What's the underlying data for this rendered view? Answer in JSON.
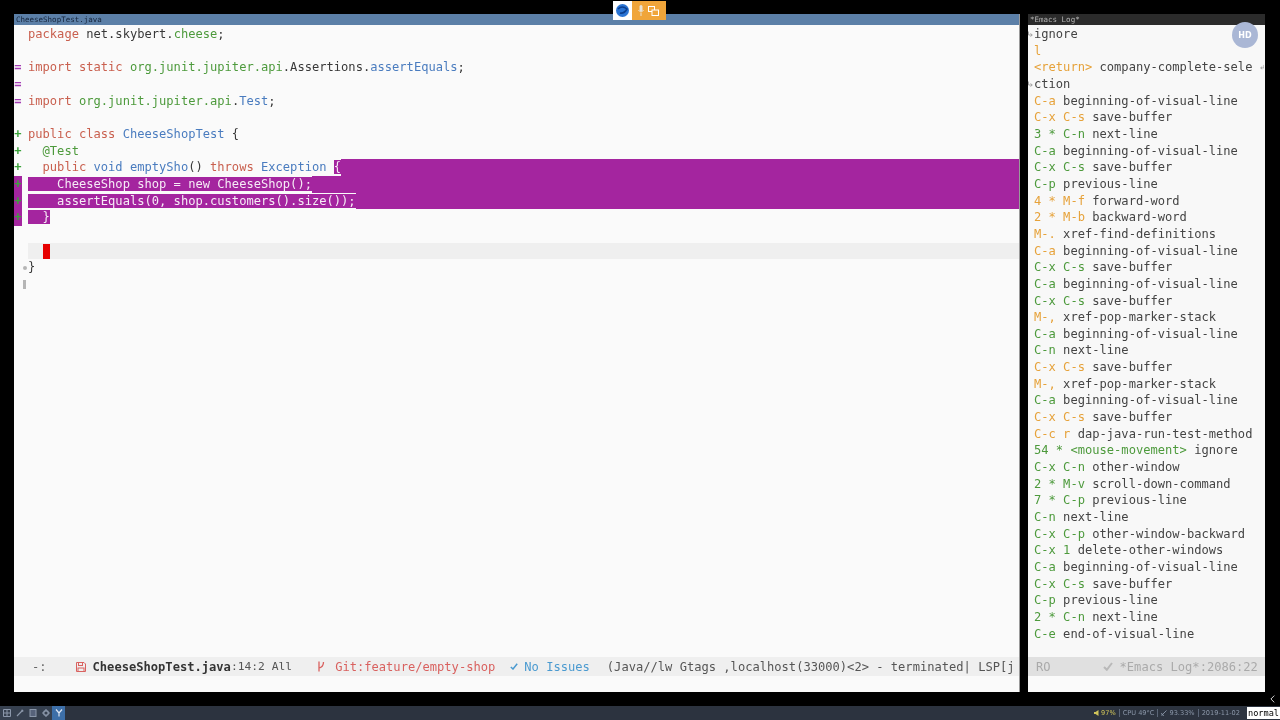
{
  "editor": {
    "title": "CheeseShopTest.java",
    "lines": [
      {
        "tokens": [
          {
            "text": "package",
            "kind": "keyword",
            "selected": false
          },
          {
            "text": " net.skybert.",
            "kind": "plain",
            "selected": false
          },
          {
            "text": "cheese",
            "kind": "namespace",
            "selected": false
          },
          {
            "text": ";",
            "kind": "plain",
            "selected": false
          }
        ],
        "current": false,
        "cursor": false,
        "selection_to_eol": false
      },
      {
        "current": false,
        "cursor": false,
        "selection_to_eol": false
      },
      {
        "marker": {
          "text": "=",
          "kind": "modified"
        },
        "tokens": [
          {
            "text": "import static ",
            "kind": "keyword",
            "selected": false
          },
          {
            "text": "org.junit.jupiter.api",
            "kind": "namespace",
            "selected": false
          },
          {
            "text": ".Assertions.",
            "kind": "plain",
            "selected": false
          },
          {
            "text": "assertEquals",
            "kind": "type",
            "selected": false
          },
          {
            "text": ";",
            "kind": "plain",
            "selected": false
          }
        ],
        "current": false,
        "cursor": false,
        "selection_to_eol": false
      },
      {
        "marker": {
          "text": "=",
          "kind": "modified"
        },
        "current": false,
        "cursor": false,
        "selection_to_eol": false
      },
      {
        "marker": {
          "text": "=",
          "kind": "modified"
        },
        "tokens": [
          {
            "text": "import ",
            "kind": "keyword",
            "selected": false
          },
          {
            "text": "org.junit.jupiter.api",
            "kind": "namespace",
            "selected": false
          },
          {
            "text": ".",
            "kind": "plain",
            "selected": false
          },
          {
            "text": "Test",
            "kind": "type",
            "selected": false
          },
          {
            "text": ";",
            "kind": "plain",
            "selected": false
          }
        ],
        "current": false,
        "cursor": false,
        "selection_to_eol": false
      },
      {
        "current": false,
        "cursor": false,
        "selection_to_eol": false
      },
      {
        "marker": {
          "text": "+",
          "kind": "added"
        },
        "tokens": [
          {
            "text": "public class ",
            "kind": "keyword",
            "selected": false
          },
          {
            "text": "CheeseShopTest",
            "kind": "type",
            "selected": false
          },
          {
            "text": " {",
            "kind": "plain",
            "selected": false
          }
        ],
        "current": false,
        "cursor": false,
        "selection_to_eol": false
      },
      {
        "marker": {
          "text": "+",
          "kind": "added"
        },
        "tokens": [
          {
            "text": "  @Test",
            "kind": "namespace",
            "selected": false
          }
        ],
        "current": false,
        "cursor": false,
        "selection_to_eol": false
      },
      {
        "marker": {
          "text": "+",
          "kind": "added"
        },
        "tokens": [
          {
            "text": "  public ",
            "kind": "keyword",
            "selected": false
          },
          {
            "text": "void emptySho",
            "kind": "type",
            "selected": false
          },
          {
            "text": "() ",
            "kind": "plain",
            "selected": false
          },
          {
            "text": "throws ",
            "kind": "keyword",
            "selected": false
          },
          {
            "text": "Exception ",
            "kind": "type",
            "selected": false
          },
          {
            "text": "{",
            "selected": true
          }
        ],
        "current": false,
        "cursor": false,
        "selection_to_eol": true
      },
      {
        "marker": {
          "text": "+",
          "kind": "added"
        },
        "tokens": [
          {
            "text": "    CheeseShop shop = new CheeseShop();",
            "selected": true
          }
        ],
        "current": false,
        "cursor": false,
        "selection_to_eol": true
      },
      {
        "marker": {
          "text": "+",
          "kind": "added"
        },
        "tokens": [
          {
            "text": "    assertEquals(0, shop.customers().size());",
            "selected": true
          }
        ],
        "current": false,
        "cursor": false,
        "selection_to_eol": true
      },
      {
        "marker": {
          "text": "+",
          "kind": "added"
        },
        "tokens": [
          {
            "text": "  }",
            "selected": true
          }
        ],
        "current": false,
        "cursor": false,
        "selection_to_eol": false
      },
      {
        "current": false,
        "cursor": false,
        "selection_to_eol": false
      },
      {
        "current": true,
        "cursor": true,
        "selection_to_eol": false
      },
      {
        "fringe": {
          "kind": "dot"
        },
        "tokens": [
          {
            "text": "}",
            "kind": "plain",
            "selected": false
          }
        ],
        "current": false,
        "cursor": false,
        "selection_to_eol": false
      },
      {
        "fringe": {
          "kind": "bar"
        },
        "current": false,
        "cursor": false,
        "selection_to_eol": false
      }
    ],
    "mode_line": {
      "state": "-:",
      "buffer": "CheeseShopTest.java",
      "position": ":14:2 All",
      "branch": "Git:feature/empty-shop",
      "checker": "No Issues",
      "modes": "(Java//lw Gtags ,localhost(33000)<2> - terminated| LSP[j"
    }
  },
  "log_window": {
    "title": "*Emacs Log*",
    "lines": [
      {
        "command": "ignore",
        "continued": true,
        "wraps": false
      },
      {
        "keys": "l",
        "highlighted": true,
        "continued": false,
        "wraps": false
      },
      {
        "keys": "<return>",
        "command": "company-complete-sele",
        "highlighted": true,
        "continued": false,
        "wraps": true
      },
      {
        "command": "ction",
        "continued": true,
        "wraps": false
      },
      {
        "keys": "C-a",
        "command": "beginning-of-visual-line",
        "highlighted": true,
        "continued": false,
        "wraps": false
      },
      {
        "keys": "C-x C-s",
        "command": "save-buffer",
        "highlighted": true,
        "continued": false,
        "wraps": false
      },
      {
        "keys": "3 * C-n",
        "command": "next-line",
        "highlighted": false,
        "continued": false,
        "wraps": false
      },
      {
        "keys": "C-a",
        "command": "beginning-of-visual-line",
        "highlighted": false,
        "continued": false,
        "wraps": false
      },
      {
        "keys": "C-x C-s",
        "command": "save-buffer",
        "highlighted": false,
        "continued": false,
        "wraps": false
      },
      {
        "keys": "C-p",
        "command": "previous-line",
        "highlighted": false,
        "continued": false,
        "wraps": false
      },
      {
        "keys": "4 * M-f",
        "command": "forward-word",
        "highlighted": true,
        "continued": false,
        "wraps": false
      },
      {
        "keys": "2 * M-b",
        "command": "backward-word",
        "highlighted": true,
        "continued": false,
        "wraps": false
      },
      {
        "keys": "M-.",
        "command": "xref-find-definitions",
        "highlighted": true,
        "continued": false,
        "wraps": false
      },
      {
        "keys": "C-a",
        "command": "beginning-of-visual-line",
        "highlighted": true,
        "continued": false,
        "wraps": false
      },
      {
        "keys": "C-x C-s",
        "command": "save-buffer",
        "highlighted": false,
        "continued": false,
        "wraps": false
      },
      {
        "keys": "C-a",
        "command": "beginning-of-visual-line",
        "highlighted": false,
        "continued": false,
        "wraps": false
      },
      {
        "keys": "C-x C-s",
        "command": "save-buffer",
        "highlighted": false,
        "continued": false,
        "wraps": false
      },
      {
        "keys": "M-,",
        "command": "xref-pop-marker-stack",
        "highlighted": true,
        "continued": false,
        "wraps": false
      },
      {
        "keys": "C-a",
        "command": "beginning-of-visual-line",
        "highlighted": false,
        "continued": false,
        "wraps": false
      },
      {
        "keys": "C-n",
        "command": "next-line",
        "highlighted": false,
        "continued": false,
        "wraps": false
      },
      {
        "keys": "C-x C-s",
        "command": "save-buffer",
        "highlighted": true,
        "continued": false,
        "wraps": false
      },
      {
        "keys": "M-,",
        "command": "xref-pop-marker-stack",
        "highlighted": true,
        "continued": false,
        "wraps": false
      },
      {
        "keys": "C-a",
        "command": "beginning-of-visual-line",
        "highlighted": false,
        "continued": false,
        "wraps": false
      },
      {
        "keys": "C-x C-s",
        "command": "save-buffer",
        "highlighted": true,
        "continued": false,
        "wraps": false
      },
      {
        "keys": "C-c r",
        "command": "dap-java-run-test-method",
        "highlighted": true,
        "continued": false,
        "wraps": false
      },
      {
        "keys": "54 * <mouse-movement>",
        "command": "ignore",
        "highlighted": false,
        "continued": false,
        "wraps": false
      },
      {
        "keys": "C-x C-n",
        "command": "other-window",
        "highlighted": false,
        "continued": false,
        "wraps": false
      },
      {
        "keys": "2 * M-v",
        "command": "scroll-down-command",
        "highlighted": false,
        "continued": false,
        "wraps": false
      },
      {
        "keys": "7 * C-p",
        "command": "previous-line",
        "highlighted": false,
        "continued": false,
        "wraps": false
      },
      {
        "keys": "C-n",
        "command": "next-line",
        "highlighted": false,
        "continued": false,
        "wraps": false
      },
      {
        "keys": "C-x C-p",
        "command": "other-window-backward",
        "highlighted": false,
        "continued": false,
        "wraps": false
      },
      {
        "keys": "C-x 1",
        "command": "delete-other-windows",
        "highlighted": false,
        "continued": false,
        "wraps": false
      },
      {
        "keys": "C-a",
        "command": "beginning-of-visual-line",
        "highlighted": false,
        "continued": false,
        "wraps": false
      },
      {
        "keys": "C-x C-s",
        "command": "save-buffer",
        "highlighted": false,
        "continued": false,
        "wraps": false
      },
      {
        "keys": "C-p",
        "command": "previous-line",
        "highlighted": false,
        "continued": false,
        "wraps": false
      },
      {
        "keys": "2 * C-n",
        "command": "next-line",
        "highlighted": false,
        "continued": false,
        "wraps": false
      },
      {
        "keys": "C-e",
        "command": "end-of-visual-line",
        "highlighted": false,
        "continued": false,
        "wraps": false
      }
    ],
    "mode_line": {
      "state": "RO",
      "buffer": "*Emacs Log*:2086:22"
    }
  },
  "avatar": {
    "initials": "HD"
  },
  "taskbar": {
    "launchers": [
      {
        "kind": "grid",
        "selected": false
      },
      {
        "kind": "pen",
        "selected": false
      },
      {
        "kind": "box",
        "selected": false
      },
      {
        "kind": "gear",
        "selected": false
      },
      {
        "kind": "fork",
        "selected": true
      }
    ],
    "status": [
      {
        "kind": "volume",
        "text": "97%"
      },
      {
        "kind": "plain",
        "text": "CPU 49°C"
      },
      {
        "kind": "network",
        "text": "93.33%"
      },
      {
        "kind": "plain",
        "text": "2019-11-02"
      }
    ],
    "mode": "normal"
  }
}
